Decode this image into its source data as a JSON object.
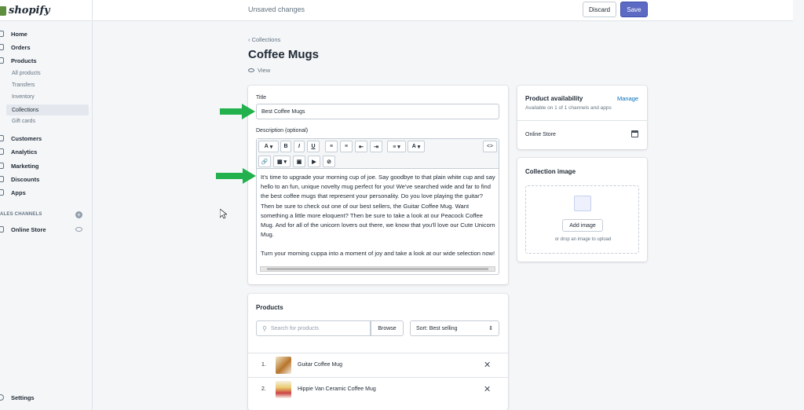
{
  "topbar": {
    "brand": "shopify",
    "unsaved": "Unsaved changes",
    "discard": "Discard",
    "save": "Save"
  },
  "sidebar": {
    "home": "Home",
    "orders": "Orders",
    "products": "Products",
    "sub": [
      "All products",
      "Transfers",
      "Inventory",
      "Collections",
      "Gift cards"
    ],
    "customers": "Customers",
    "analytics": "Analytics",
    "marketing": "Marketing",
    "discounts": "Discounts",
    "apps": "Apps",
    "sales_channels": "ALES CHANNELS",
    "online_store": "Online Store",
    "settings": "Settings"
  },
  "page": {
    "back": "Collections",
    "title": "Coffee Mugs",
    "view": "View"
  },
  "form": {
    "title_label": "Title",
    "title_value": "Best Coffee Mugs",
    "desc_label": "Description (optional)",
    "paragraph1": "It's time to upgrade your morning cup of joe. Say goodbye to that plain white cup and say hello to an fun, unique novelty mug perfect for you! We've searched wide and far to find the best coffee mugs that represent your personality. Do you love playing the guitar? Then be sure to check out one of our best sellers, the Guitar Coffee Mug. Want something a little more eloquent? Then be sure to take a look at our Peacock Coffee Mug. And for all of the unicorn lovers out there, we know that you'll love our Cute Unicorn Mug.",
    "paragraph2": "Turn your morning cuppa into a moment of joy and take a look at our wide selection now!",
    "toolbar": {
      "font": "A",
      "bold": "B",
      "italic": "I",
      "underline": "U",
      "color": "A",
      "code": "<>"
    }
  },
  "availability": {
    "heading": "Product availability",
    "manage": "Manage",
    "sub": "Available on 1 of 1 channels and apps",
    "channel": "Online Store"
  },
  "collection_image": {
    "heading": "Collection image",
    "button": "Add image",
    "hint": "or drop an image to upload"
  },
  "products": {
    "heading": "Products",
    "search_placeholder": "Search for products",
    "browse": "Browse",
    "sort": "Sort: Best selling",
    "items": [
      {
        "num": "1.",
        "name": "Guitar Coffee Mug"
      },
      {
        "num": "2.",
        "name": "Hippie Van Ceramic Coffee Mug"
      }
    ]
  },
  "colors": {
    "accent": "#5c6ac4",
    "arrow": "#22b14c",
    "link": "#006fbb"
  }
}
